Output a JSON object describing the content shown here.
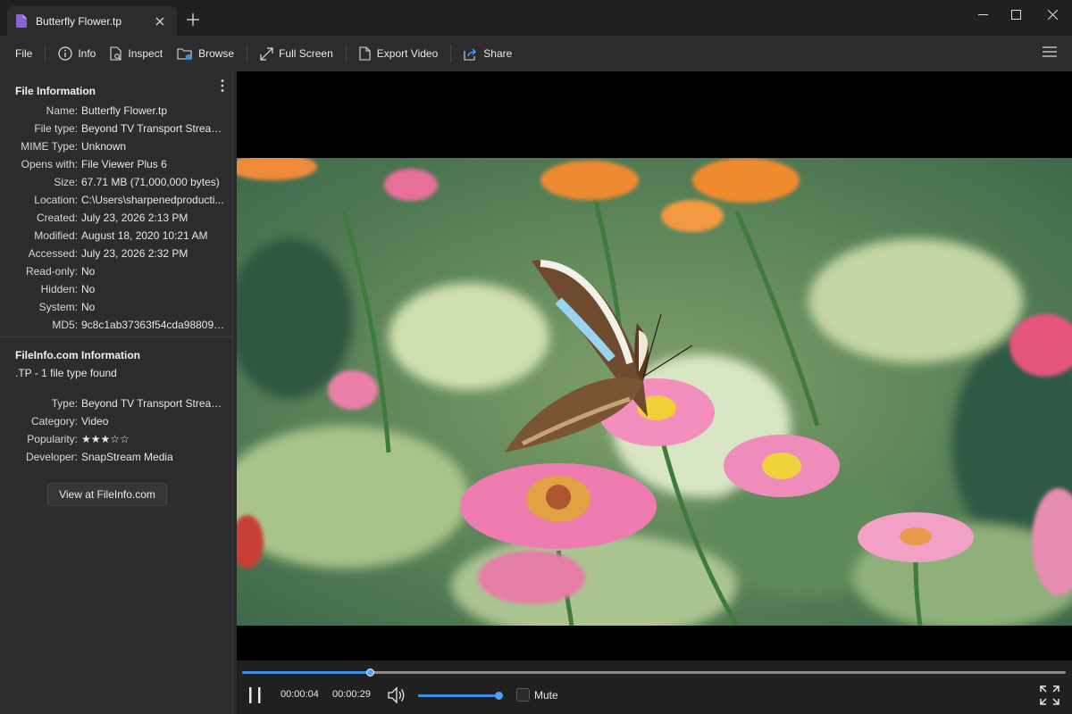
{
  "tab": {
    "title": "Butterfly Flower.tp",
    "icon": "file-icon",
    "accent": "#8a63d2"
  },
  "toolbar": {
    "file": "File",
    "info": "Info",
    "inspect": "Inspect",
    "browse": "Browse",
    "full_screen": "Full Screen",
    "export_video": "Export Video",
    "share": "Share"
  },
  "file_info": {
    "title": "File Information",
    "rows": [
      {
        "key": "Name:",
        "value": "Butterfly Flower.tp"
      },
      {
        "key": "File type:",
        "value": "Beyond TV Transport Stream ..."
      },
      {
        "key": "MIME Type:",
        "value": "Unknown"
      },
      {
        "key": "Opens with:",
        "value": "File Viewer Plus 6"
      },
      {
        "key": "Size:",
        "value": "67.71 MB (71,000,000 bytes)"
      },
      {
        "key": "Location:",
        "value": "C:\\Users\\sharpenedproducti..."
      },
      {
        "key": "Created:",
        "value": "July 23, 2026 2:13 PM"
      },
      {
        "key": "Modified:",
        "value": "August 18, 2020 10:21 AM"
      },
      {
        "key": "Accessed:",
        "value": "July 23, 2026 2:32 PM"
      },
      {
        "key": "Read-only:",
        "value": "No"
      },
      {
        "key": "Hidden:",
        "value": "No"
      },
      {
        "key": "System:",
        "value": "No"
      },
      {
        "key": "MD5:",
        "value": "9c8c1ab37363f54cda98809c5..."
      }
    ]
  },
  "fileinfo_com": {
    "title": "FileInfo.com Information",
    "subtitle": ".TP - 1 file type found",
    "rows": [
      {
        "key": "Type:",
        "value": "Beyond TV Transport Stream ..."
      },
      {
        "key": "Category:",
        "value": "Video"
      },
      {
        "key": "Popularity:",
        "value": "★★★☆☆"
      },
      {
        "key": "Developer:",
        "value": "SnapStream Media"
      }
    ],
    "popularity_stars": 3,
    "view_button": "View at FileInfo.com"
  },
  "player": {
    "current_time": "00:00:04",
    "duration": "00:00:29",
    "progress": 0.155,
    "volume": 0.95,
    "mute_label": "Mute",
    "muted": false,
    "accent": "#3a8ee6"
  }
}
